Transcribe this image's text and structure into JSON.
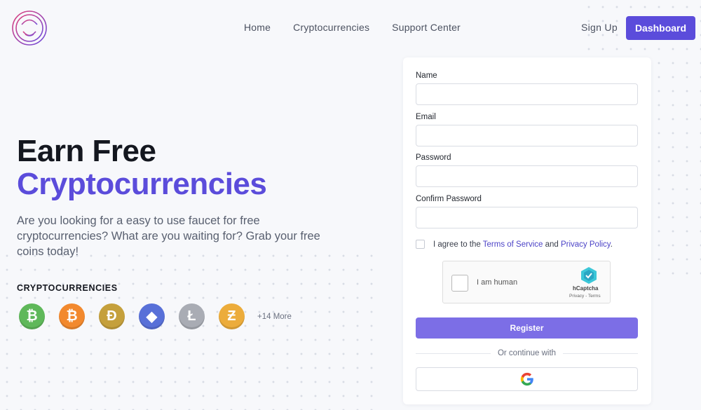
{
  "nav": {
    "items": [
      "Home",
      "Cryptocurrencies",
      "Support Center"
    ],
    "signup_label": "Sign Up",
    "dashboard_label": "Dashboard"
  },
  "hero": {
    "title_line1": "Earn Free",
    "title_line2": "Cryptocurrencies",
    "description": "Are you looking for a easy to use faucet for free cryptocurrencies? What are you waiting for? Grab your free coins today!"
  },
  "cryptocurrencies": {
    "heading": "CRYPTOCURRENCIES",
    "coins": [
      {
        "icon": "bitcoin-cash-icon",
        "symbol": "₿",
        "color": "#5fb85a"
      },
      {
        "icon": "bitcoin-icon",
        "symbol": "₿",
        "color": "#f2892e"
      },
      {
        "icon": "dogecoin-icon",
        "symbol": "Ð",
        "color": "#c5a03c"
      },
      {
        "icon": "ethereum-icon",
        "symbol": "◆",
        "color": "#5870d8"
      },
      {
        "icon": "litecoin-icon",
        "symbol": "Ł",
        "color": "#a9acb4"
      },
      {
        "icon": "zcash-icon",
        "symbol": "Ƶ",
        "color": "#ecac3b"
      }
    ],
    "more_label": "+14 More"
  },
  "form": {
    "name_label": "Name",
    "email_label": "Email",
    "password_label": "Password",
    "confirm_label": "Confirm Password",
    "agree_prefix": "I agree to the ",
    "terms_link": "Terms of Service",
    "agree_and": " and ",
    "privacy_link": "Privacy Policy",
    "agree_suffix": ".",
    "register_label": "Register",
    "divider_text": "Or continue with"
  },
  "captcha": {
    "label": "I am human",
    "brand": "hCaptcha",
    "links": "Privacy - Terms"
  },
  "colors": {
    "accent": "#5b4cdb",
    "register_button": "#7c6ee6",
    "link": "#4c43c7"
  }
}
